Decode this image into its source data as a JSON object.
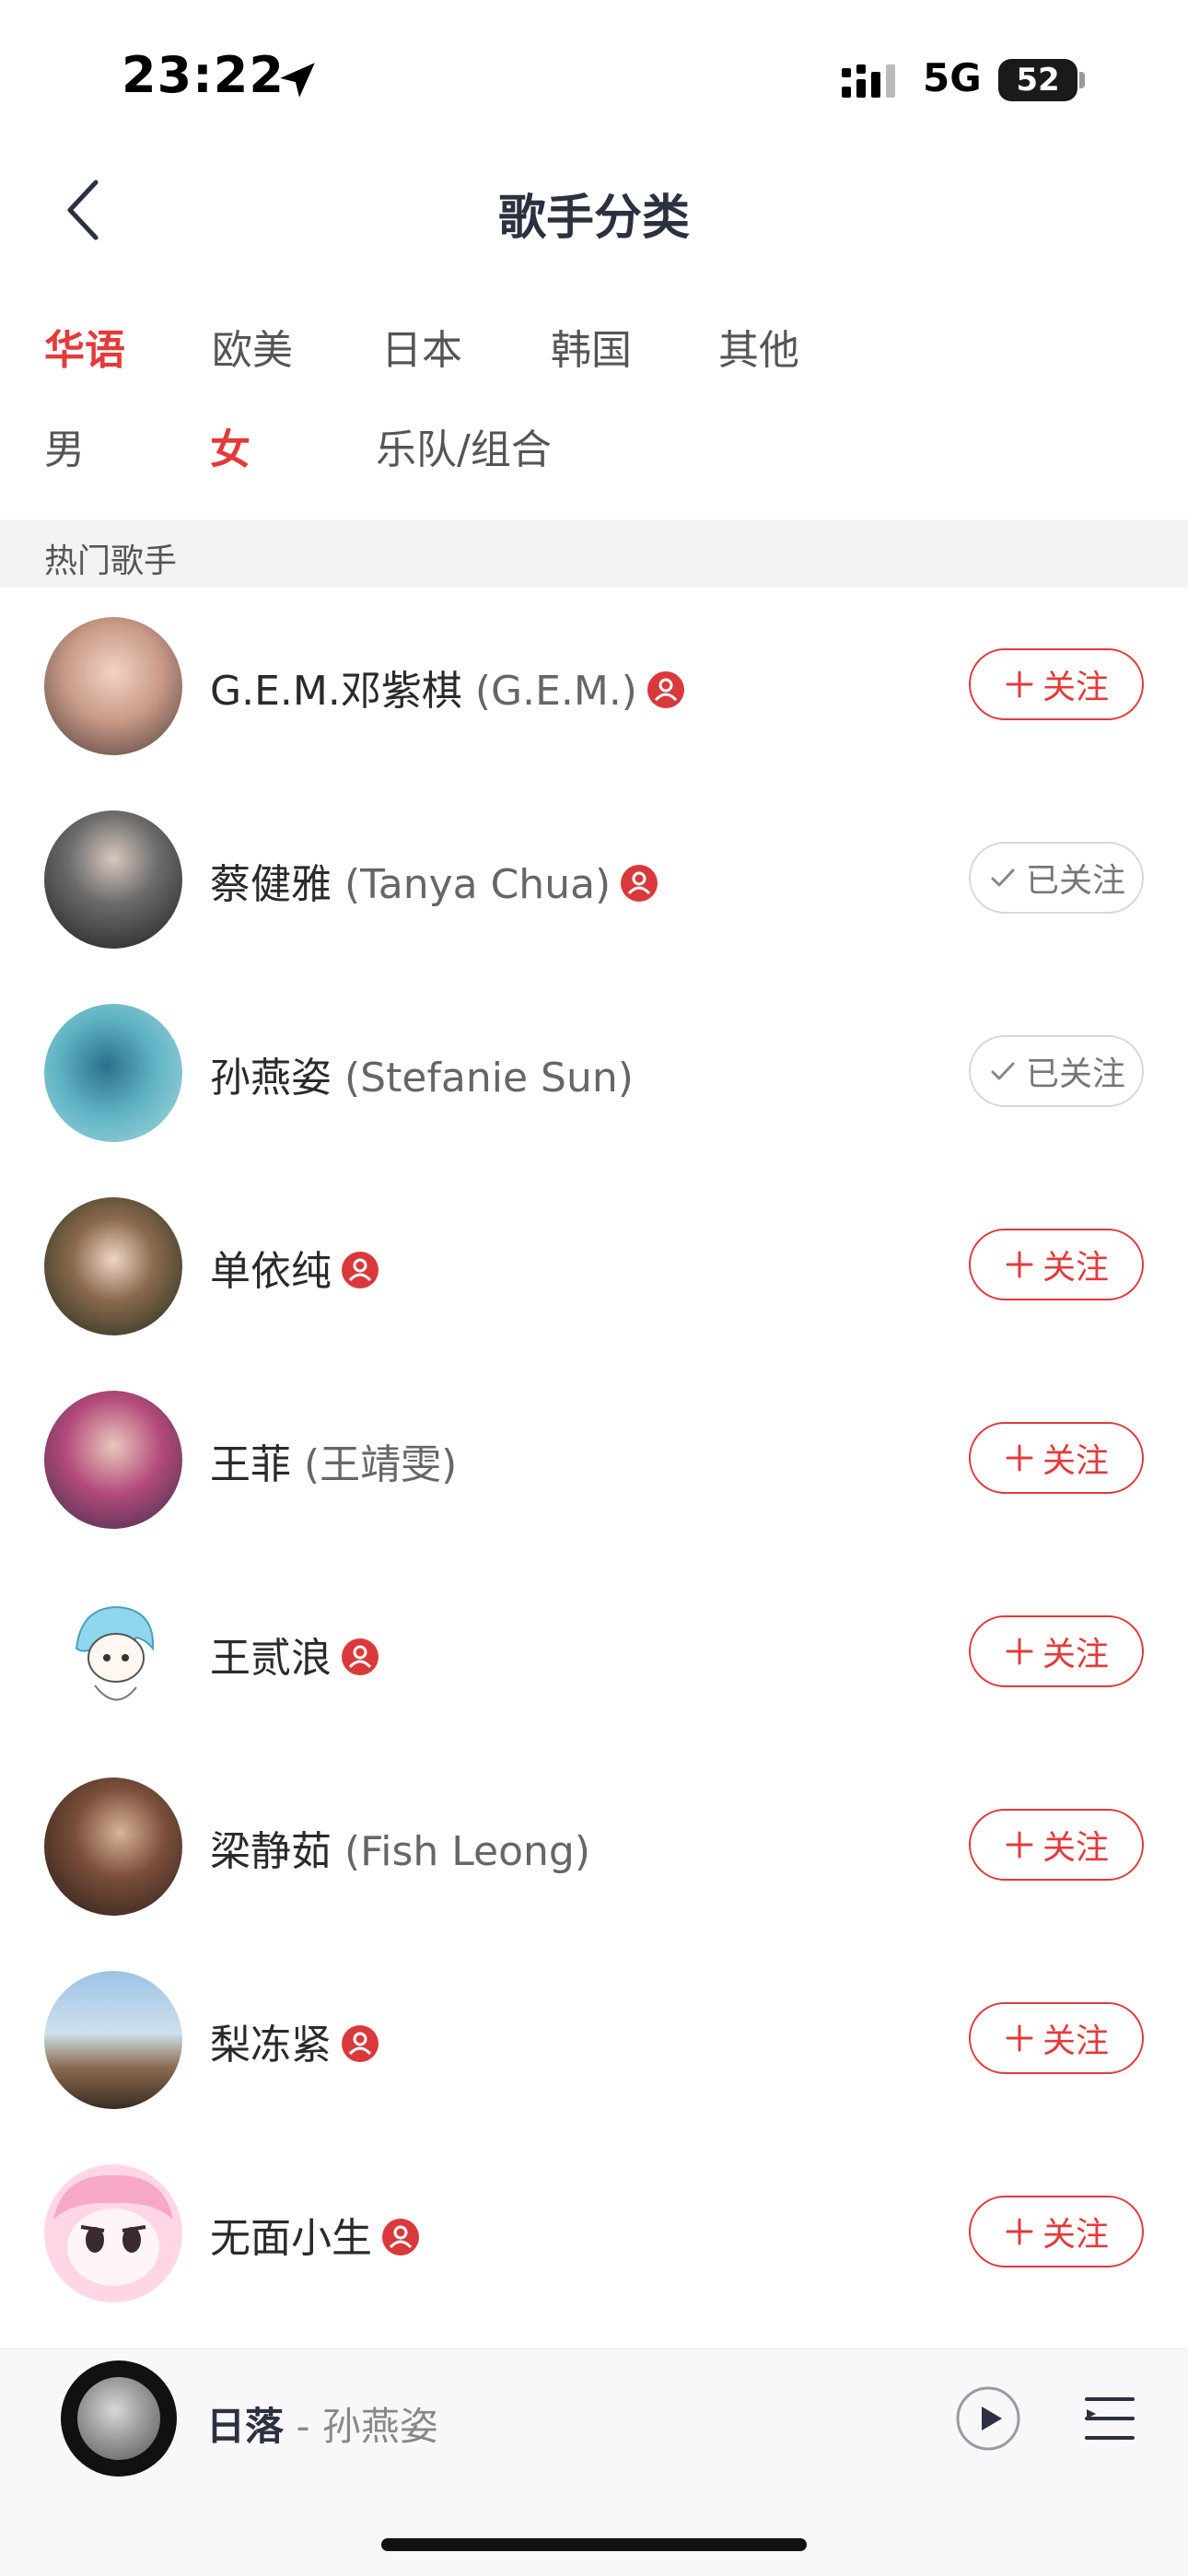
{
  "status_bar": {
    "time": "23:22",
    "network": "5G",
    "battery": "52"
  },
  "nav": {
    "title": "歌手分类"
  },
  "filters": {
    "region": [
      {
        "label": "华语",
        "active": true
      },
      {
        "label": "欧美",
        "active": false
      },
      {
        "label": "日本",
        "active": false
      },
      {
        "label": "韩国",
        "active": false
      },
      {
        "label": "其他",
        "active": false
      }
    ],
    "gender": [
      {
        "label": "男",
        "active": false
      },
      {
        "label": "女",
        "active": true
      },
      {
        "label": "乐队/组合",
        "active": false
      }
    ]
  },
  "section": {
    "title": "热门歌手"
  },
  "buttons": {
    "follow": "关注",
    "followed": "已关注"
  },
  "artists": [
    {
      "name": "G.E.M.邓紫棋",
      "alias": " (G.E.M.)",
      "verified": true,
      "followed": false
    },
    {
      "name": "蔡健雅",
      "alias": " (Tanya Chua)",
      "verified": true,
      "followed": true
    },
    {
      "name": "孙燕姿",
      "alias": " (Stefanie Sun)",
      "verified": false,
      "followed": true
    },
    {
      "name": "单依纯",
      "alias": "",
      "verified": true,
      "followed": false
    },
    {
      "name": "王菲",
      "alias": " (王靖雯)",
      "verified": false,
      "followed": false
    },
    {
      "name": "王贰浪",
      "alias": "",
      "verified": true,
      "followed": false
    },
    {
      "name": "梁静茹",
      "alias": " (Fish Leong)",
      "verified": false,
      "followed": false
    },
    {
      "name": "梨冻紧",
      "alias": "",
      "verified": true,
      "followed": false
    },
    {
      "name": "无面小生",
      "alias": "",
      "verified": true,
      "followed": false
    }
  ],
  "now_playing": {
    "song": "日落",
    "separator": " - ",
    "artist": "孙燕姿"
  },
  "colors": {
    "accent": "#e33a3a",
    "title": "#2c3140",
    "section_bg": "#f3f3f5"
  }
}
